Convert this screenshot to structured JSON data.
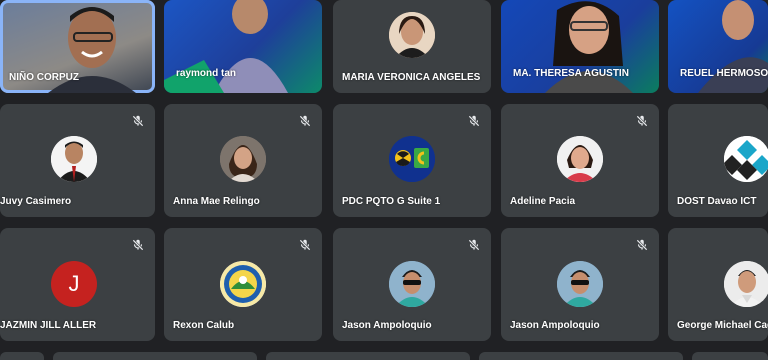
{
  "participants": [
    {
      "name": "NIÑO CORPUZ"
    },
    {
      "name": "raymond tan"
    },
    {
      "name": "MARIA VERONICA ANGELES"
    },
    {
      "name": "MA. THERESA AGUSTIN"
    },
    {
      "name": "REUEL HERMOSO"
    },
    {
      "name": "Juvy Casimero"
    },
    {
      "name": "Anna Mae Relingo"
    },
    {
      "name": "PDC PQTO G Suite 1"
    },
    {
      "name": "Adeline Pacia"
    },
    {
      "name": "DOST Davao ICT"
    },
    {
      "name": "JAZMIN JILL ALLER",
      "initial": "J"
    },
    {
      "name": "Rexon Calub"
    },
    {
      "name": "Jason Ampoloquio"
    },
    {
      "name": "Jason Ampoloquio"
    },
    {
      "name": "George Michael Cag"
    }
  ],
  "colors": {
    "background": "#202124",
    "tile": "#3c4043",
    "active_speaker": "#8ab4f8",
    "initial_avatar": "#c5221f"
  }
}
